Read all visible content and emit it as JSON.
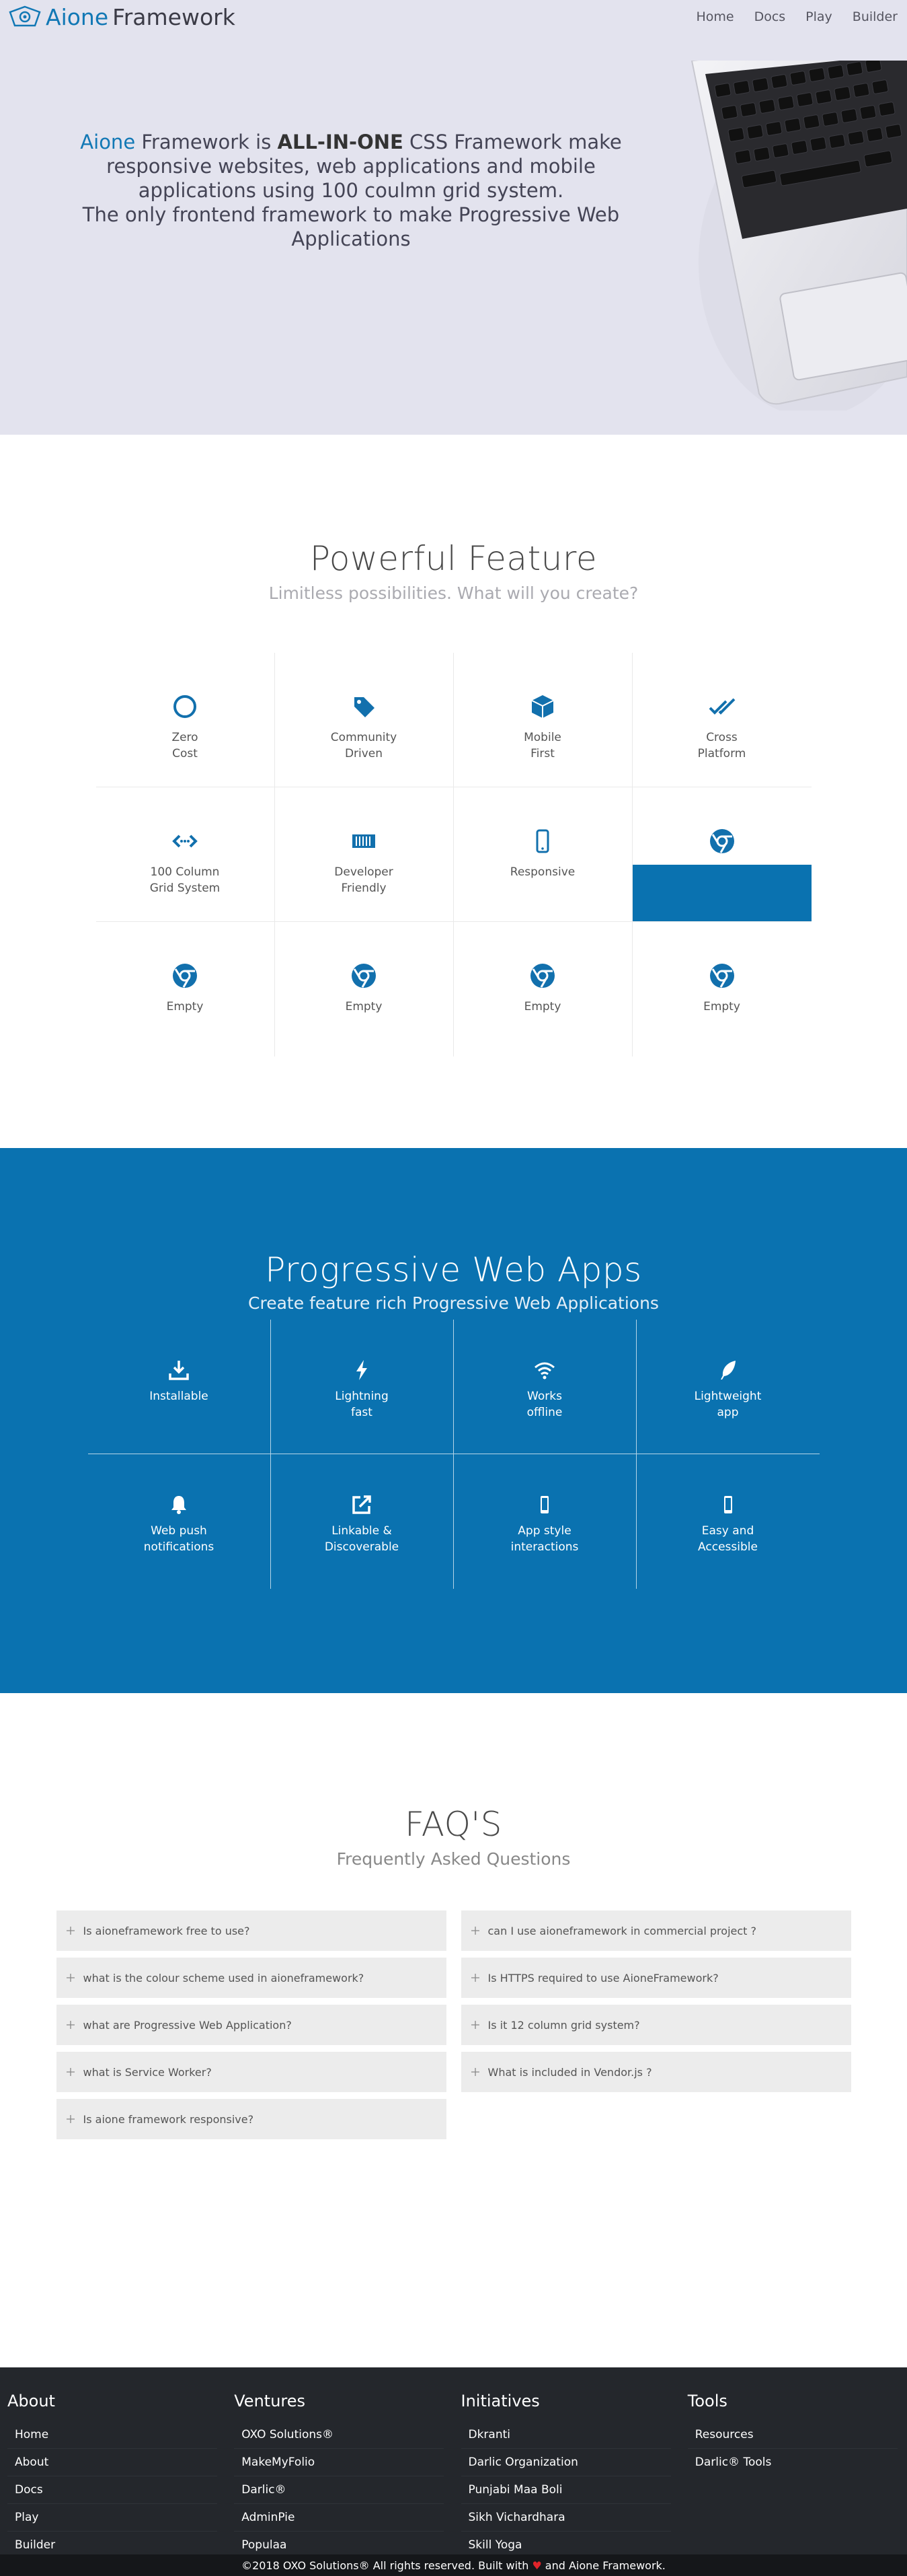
{
  "header": {
    "brand_prefix": "Aione",
    "brand_suffix": "Framework",
    "menu": [
      "Home",
      "Docs",
      "Play",
      "Builder"
    ]
  },
  "hero": {
    "accent_word": "Aione",
    "line1_mid": "Framework is",
    "line1_bold": "ALL-IN-ONE",
    "line1_rest": "CSS Framework make responsive websites, web applications and mobile applications using 100 coulmn grid system.",
    "line2": "The only frontend framework to make Progressive Web Applications"
  },
  "features": {
    "title": "Powerful Feature",
    "subtitle": "Limitless possibilities. What will you create?",
    "items": [
      {
        "label": "Zero\nCost",
        "icon": "circle-icon"
      },
      {
        "label": "Community\nDriven",
        "icon": "tag-icon"
      },
      {
        "label": "Mobile\nFirst",
        "icon": "cube-icon"
      },
      {
        "label": "Cross\nPlatform",
        "icon": "double-check-icon"
      },
      {
        "label": "100 Column\nGrid System",
        "icon": "code-arrows-icon"
      },
      {
        "label": "Developer\nFriendly",
        "icon": "barcode-icon"
      },
      {
        "label": "Responsive",
        "icon": "mobile-icon"
      },
      {
        "label": "",
        "icon": "chrome-icon"
      },
      {
        "label": "Empty",
        "icon": "chrome-icon"
      },
      {
        "label": "Empty",
        "icon": "chrome-icon"
      },
      {
        "label": "Empty",
        "icon": "chrome-icon"
      },
      {
        "label": "Empty",
        "icon": "chrome-icon"
      }
    ]
  },
  "pwa": {
    "title": "Progressive Web Apps",
    "subtitle": "Create feature rich Progressive Web Applications",
    "items": [
      {
        "label": "Installable",
        "icon": "download-icon"
      },
      {
        "label": "Lightning\nfast",
        "icon": "lightning-icon"
      },
      {
        "label": "Works\noffline",
        "icon": "wifi-icon"
      },
      {
        "label": "Lightweight\napp",
        "icon": "feather-icon"
      },
      {
        "label": "Web push\nnotifications",
        "icon": "bell-icon"
      },
      {
        "label": "Linkable &\nDiscoverable",
        "icon": "external-link-icon"
      },
      {
        "label": "App style\ninteractions",
        "icon": "phone-icon"
      },
      {
        "label": "Easy and\nAccessible",
        "icon": "phone-icon"
      }
    ]
  },
  "faq": {
    "title": "FAQ'S",
    "subtitle": "Frequently Asked Questions",
    "left": [
      "Is aioneframework free to use?",
      "what is the colour scheme used in aioneframework?",
      "what are Progressive Web Application?",
      "what is Service Worker?",
      "Is aione framework responsive?"
    ],
    "right": [
      "can I use aioneframework in commercial project ?",
      "Is HTTPS required to use AioneFramework?",
      "Is it 12 column grid system?",
      "What is included in Vendor.js ?"
    ]
  },
  "footer": {
    "columns": [
      {
        "title": "About",
        "links": [
          "Home",
          "About",
          "Docs",
          "Play",
          "Builder"
        ]
      },
      {
        "title": "Ventures",
        "links": [
          "OXO Solutions®",
          "MakeMyFolio",
          "Darlic®",
          "AdminPie",
          "Populaa"
        ]
      },
      {
        "title": "Initiatives",
        "links": [
          "Dkranti",
          "Darlic Organization",
          "Punjabi Maa Boli",
          "Sikh Vichardhara",
          "Skill Yoga"
        ]
      },
      {
        "title": "Tools",
        "links": [
          "Resources",
          "Darlic® Tools"
        ]
      }
    ],
    "copyright_prefix": "©2018 OXO Solutions® All rights reserved. Built with",
    "heart": "♥",
    "copyright_suffix": "and Aione Framework."
  },
  "colors": {
    "primary": "#0a72b0",
    "hero_bg": "#e3e3ee",
    "footer_bg": "#24272c",
    "faq_item_bg": "#ececec"
  }
}
